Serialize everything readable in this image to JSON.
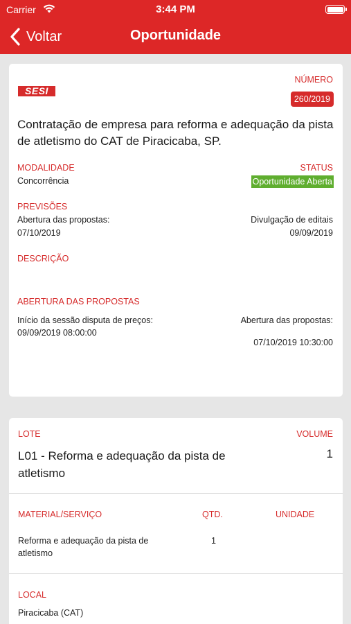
{
  "status_bar": {
    "carrier": "Carrier",
    "time": "3:44 PM"
  },
  "nav": {
    "back_label": "Voltar",
    "title": "Oportunidade"
  },
  "opportunity": {
    "logo_text": "SESI",
    "number_label": "NÚMERO",
    "number": "260/2019",
    "title": "Contratação de empresa para reforma e adequação da pista de atletismo do CAT de Piracicaba, SP.",
    "modality_label": "MODALIDADE",
    "modality": "Concorrência",
    "status_label": "STATUS",
    "status": "Oportunidade Aberta",
    "forecasts_label": "PREVISÕES",
    "opening_label": "Abertura  das propostas:",
    "opening_date": "07/10/2019",
    "publication_label": "Divulgação de editais",
    "publication_date": "09/09/2019",
    "description_label": "DESCRIÇÃO",
    "proposals_label": "ABERTURA DAS PROPOSTAS",
    "session_label": "Início da sessão disputa de preços:",
    "session_datetime": "09/09/2019 08:00:00",
    "proposals_open_label": "Abertura das propostas:",
    "proposals_open_datetime": "07/10/2019 10:30:00"
  },
  "lot": {
    "lot_label": "LOTE",
    "volume_label": "VOLUME",
    "lot_title": "L01 - Reforma e adequação da pista de atletismo",
    "volume": "1",
    "material_header": "MATERIAL/SERVIÇO",
    "qty_header": "QTD.",
    "unit_header": "UNIDADE",
    "items": [
      {
        "material": "Reforma e adequação da pista de atletismo",
        "qty": "1",
        "unit": ""
      }
    ],
    "local_label": "LOCAL",
    "local": "Piracicaba (CAT)"
  },
  "colors": {
    "brand_red": "#dd2727",
    "label_red": "#d62b2b",
    "status_green": "#5fae2f"
  }
}
